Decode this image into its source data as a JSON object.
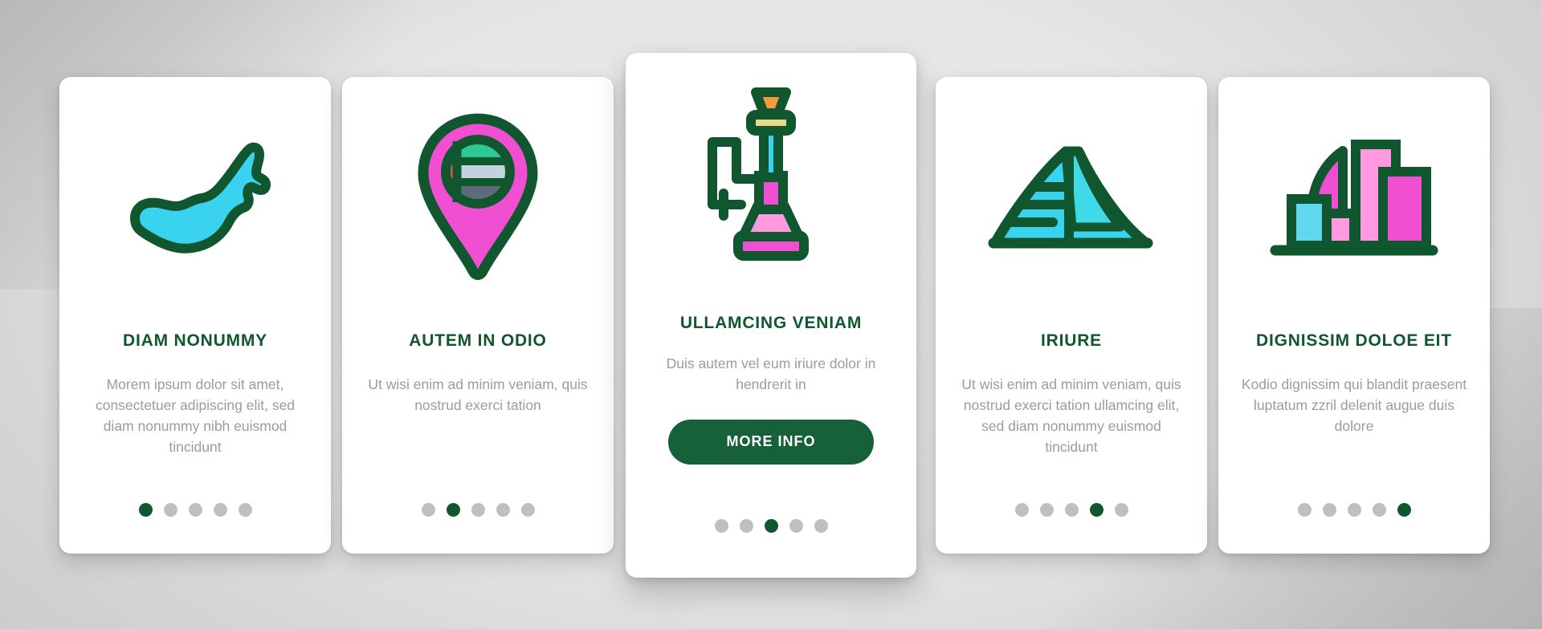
{
  "theme": {
    "outline_green": "#10572f",
    "button_green": "#16603a",
    "body_text_gray": "#96a193",
    "dot_inactive": "#bfbfbf",
    "card_background": "#ffffff",
    "page_background": "#d4d4d4",
    "accent_cyan": "#39d2ef",
    "accent_pink": "#ef4fd0",
    "accent_light_pink": "#ff9ae0",
    "accent_orange": "#f59b3c",
    "accent_yellow": "#e8d98a",
    "accent_red": "#e8544a",
    "accent_teal": "#2fc894",
    "accent_slate": "#5d6b7a",
    "accent_pale": "#c2d3dc"
  },
  "cards": [
    {
      "id": "card-1",
      "icon": "uae-map-icon",
      "title": "DIAM NONUMMY",
      "body": "Morem ipsum dolor sit amet, consectetuer adipiscing elit, sed diam nonummy nibh euismod tincidunt",
      "dots_total": 5,
      "dots_active_index": 0,
      "has_button": false,
      "button_label": ""
    },
    {
      "id": "card-2",
      "icon": "map-pin-uae-flag-icon",
      "title": "AUTEM IN ODIO",
      "body": "Ut wisi enim ad minim veniam, quis nostrud exerci tation",
      "dots_total": 5,
      "dots_active_index": 1,
      "has_button": false,
      "button_label": ""
    },
    {
      "id": "card-3",
      "icon": "hookah-shisha-icon",
      "title": "ULLAMCING VENIAM",
      "body": "Duis autem vel eum iriure dolor in hendrerit in",
      "dots_total": 5,
      "dots_active_index": 2,
      "has_button": true,
      "button_label": "MORE INFO"
    },
    {
      "id": "card-4",
      "icon": "burj-al-arab-icon",
      "title": "IRIURE",
      "body": "Ut wisi enim ad minim veniam, quis nostrud exerci tation ullamcing elit, sed diam nonummy euismod tincidunt",
      "dots_total": 5,
      "dots_active_index": 3,
      "has_button": false,
      "button_label": ""
    },
    {
      "id": "card-5",
      "icon": "city-skyline-icon",
      "title": "DIGNISSIM DOLOE EIT",
      "body": "Kodio dignissim qui blandit praesent luptatum zzril delenit augue duis dolore",
      "dots_total": 5,
      "dots_active_index": 4,
      "has_button": false,
      "button_label": ""
    }
  ]
}
